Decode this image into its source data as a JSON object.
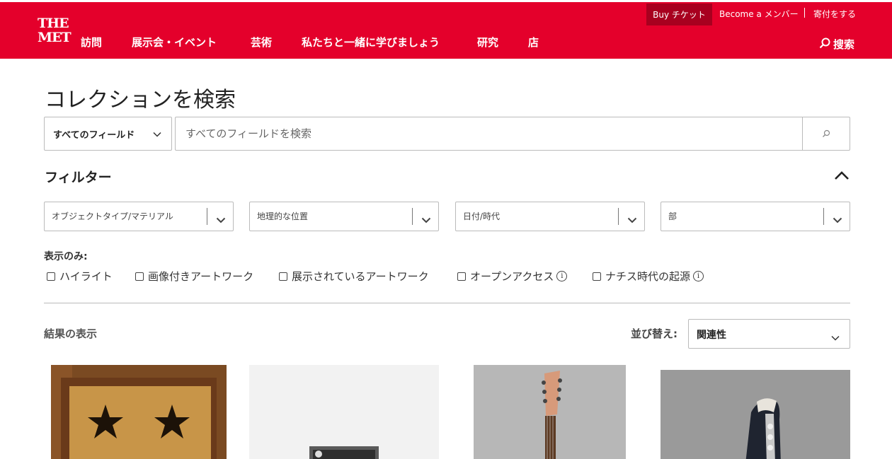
{
  "header": {
    "logo_line1": "THE",
    "logo_line2": "MET",
    "nav": [
      "訪問",
      "展示会・イベント",
      "芸術",
      "私たちと一緒に学びましょう",
      "研究",
      "店"
    ],
    "utility": {
      "buy": "Buy チケット",
      "member": "Become a メンバー",
      "donate": "寄付をする"
    },
    "search_label": "搜索",
    "brand_color": "#e4002b"
  },
  "page": {
    "title": "コレクションを検索"
  },
  "search": {
    "field_select": "すべてのフィールド",
    "placeholder": "すべてのフィールドを検索"
  },
  "filters": {
    "heading": "フィルター",
    "dropdowns": [
      "オブジェクトタイプ/マテリアル",
      "地理的な位置",
      "日付/時代",
      "部"
    ],
    "show_only_label": "表示のみ:",
    "checkboxes": [
      "ハイライト",
      "画像付きアートワーク",
      "展示されているアートワーク",
      "オープンアクセス",
      "ナチス時代の起源"
    ]
  },
  "results": {
    "label": "結果の表示",
    "sort_label": "並び替え:",
    "sort_value": "関連性"
  },
  "icons": {
    "search": "search-icon",
    "chevron_down": "chevron-down-icon",
    "chevron_up": "chevron-up-icon",
    "info": "info-icon"
  }
}
